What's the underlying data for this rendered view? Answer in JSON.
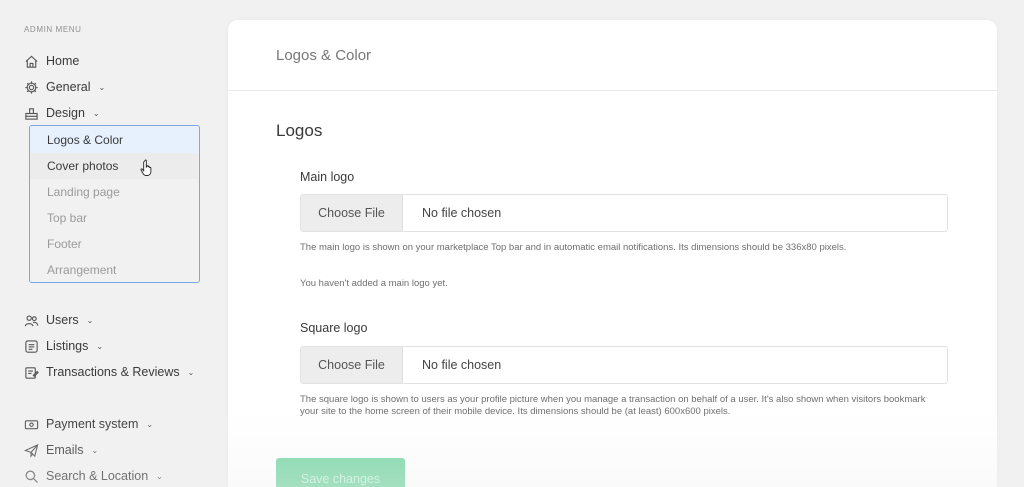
{
  "sidebar": {
    "heading": "ADMIN MENU",
    "items": [
      {
        "label": "Home",
        "icon": "home-icon"
      },
      {
        "label": "General",
        "icon": "gear-icon"
      },
      {
        "label": "Design",
        "icon": "design-icon"
      },
      {
        "label": "Users",
        "icon": "users-icon"
      },
      {
        "label": "Listings",
        "icon": "listings-icon"
      },
      {
        "label": "Transactions & Reviews",
        "icon": "transactions-icon"
      },
      {
        "label": "Payment system",
        "icon": "payment-icon"
      },
      {
        "label": "Emails",
        "icon": "email-icon"
      },
      {
        "label": "Search & Location",
        "icon": "search-icon"
      }
    ],
    "design_submenu": [
      {
        "label": "Logos & Color"
      },
      {
        "label": "Cover photos"
      },
      {
        "label": "Landing page"
      },
      {
        "label": "Top bar"
      },
      {
        "label": "Footer"
      },
      {
        "label": "Arrangement"
      }
    ]
  },
  "main": {
    "title": "Logos & Color",
    "section_title": "Logos",
    "main_logo": {
      "label": "Main logo",
      "button": "Choose File",
      "status": "No file chosen",
      "help": "The main logo is shown on your marketplace Top bar and in automatic email notifications. Its dimensions should be 336x80 pixels.",
      "note": "You haven't added a main logo yet."
    },
    "square_logo": {
      "label": "Square logo",
      "button": "Choose File",
      "status": "No file chosen",
      "help": "The square logo is shown to users as your profile picture when you manage a transaction on behalf of a user. It's also shown when visitors bookmark your site to the home screen of their mobile device. Its dimensions should be (at least) 600x600 pixels."
    },
    "save_label": "Save changes"
  },
  "colors": {
    "accent_blue": "#7aa7ea",
    "save_green": "#7ad6a6"
  }
}
